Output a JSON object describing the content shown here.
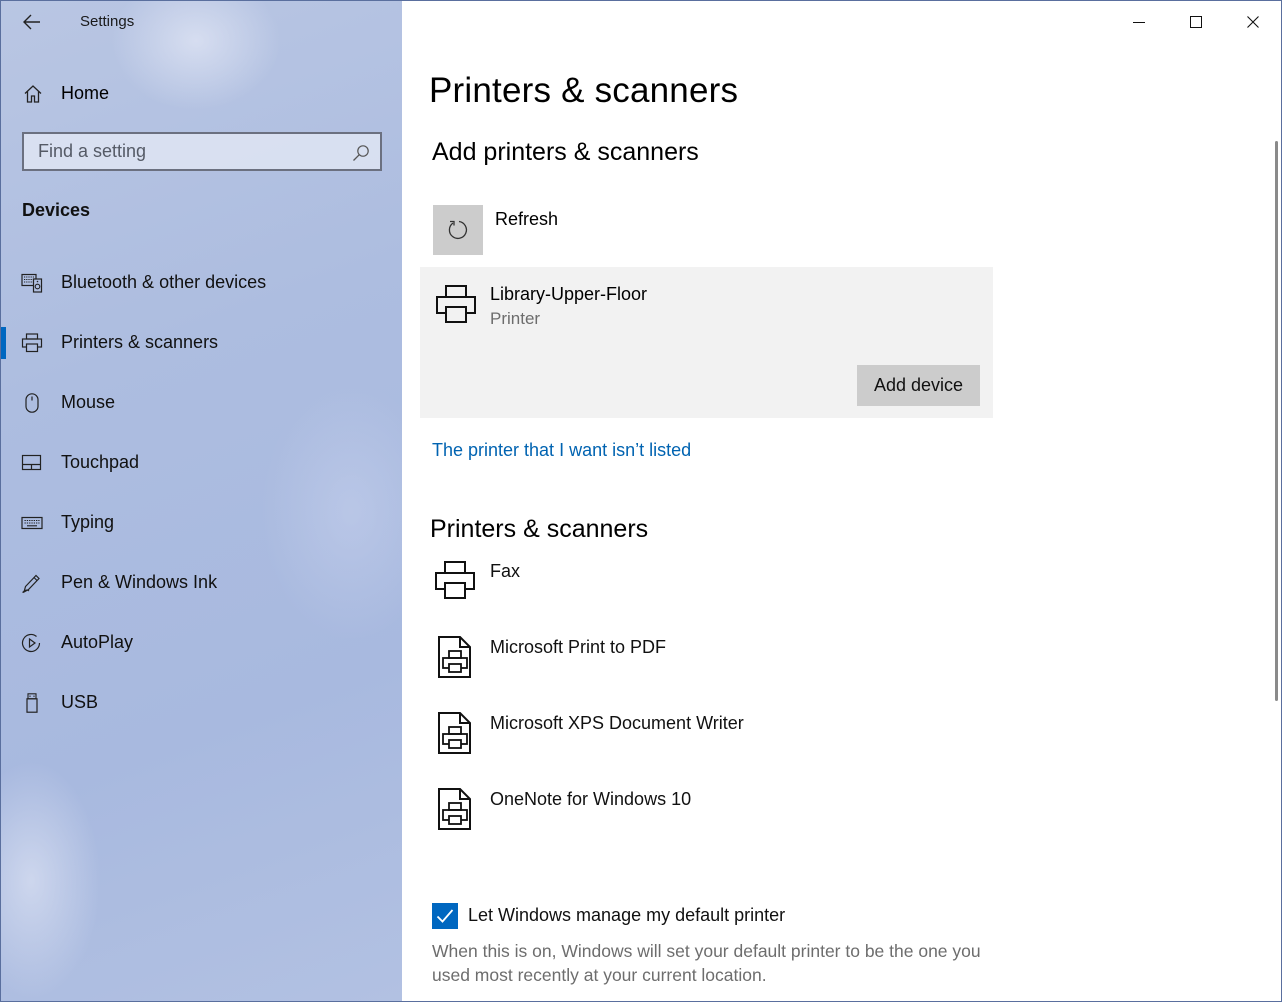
{
  "window": {
    "app_title": "Settings"
  },
  "sidebar": {
    "home_label": "Home",
    "search_placeholder": "Find a setting",
    "section_label": "Devices",
    "items": [
      {
        "label": "Bluetooth & other devices",
        "icon": "bluetooth-devices-icon"
      },
      {
        "label": "Printers & scanners",
        "icon": "printer-icon",
        "selected": true
      },
      {
        "label": "Mouse",
        "icon": "mouse-icon"
      },
      {
        "label": "Touchpad",
        "icon": "touchpad-icon"
      },
      {
        "label": "Typing",
        "icon": "keyboard-icon"
      },
      {
        "label": "Pen & Windows Ink",
        "icon": "pen-icon"
      },
      {
        "label": "AutoPlay",
        "icon": "autoplay-icon"
      },
      {
        "label": "USB",
        "icon": "usb-icon"
      }
    ],
    "accent_color": "#0067c0"
  },
  "main": {
    "page_title": "Printers & scanners",
    "add_section": {
      "heading": "Add printers & scanners",
      "refresh_label": "Refresh",
      "found_device": {
        "name": "Library-Upper-Floor",
        "type": "Printer",
        "add_button_label": "Add device"
      },
      "not_listed_link": "The printer that I want isn’t listed"
    },
    "list_section": {
      "heading": "Printers & scanners",
      "printers": [
        {
          "name": "Fax",
          "icon": "printer-icon"
        },
        {
          "name": "Microsoft Print to PDF",
          "icon": "document-printer-icon"
        },
        {
          "name": "Microsoft XPS Document Writer",
          "icon": "document-printer-icon"
        },
        {
          "name": "OneNote for Windows 10",
          "icon": "document-printer-icon"
        }
      ]
    },
    "default_printer": {
      "checkbox_label": "Let Windows manage my default printer",
      "checked": true,
      "description": "When this is on, Windows will set your default printer to be the one you used most recently at your current location."
    },
    "link_color": "#0063b1"
  }
}
